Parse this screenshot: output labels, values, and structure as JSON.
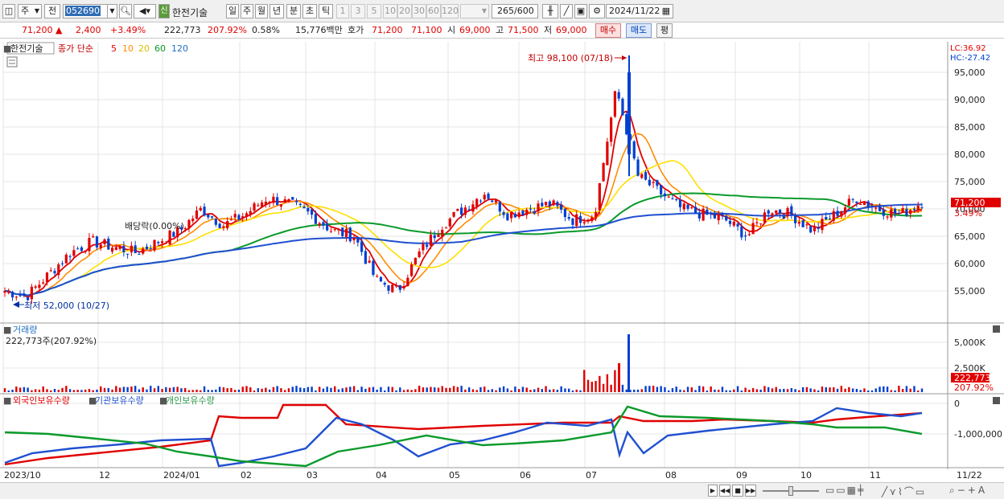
{
  "toolbar": {
    "mode_btn": "주",
    "prev_btn": "전",
    "code": "052690",
    "sin_badge": "신",
    "stock_name": "한전기술",
    "periods": [
      "일",
      "주",
      "월",
      "년",
      "분",
      "초",
      "틱"
    ],
    "selected_period": "일",
    "intervals": [
      "1",
      "3",
      "5",
      "10",
      "20",
      "30",
      "60",
      "120"
    ],
    "count": "265",
    "count_max": "/600",
    "date": "2024/11/22"
  },
  "quote": {
    "price": "71,200",
    "change": "2,400",
    "change_pct": "+3.49%",
    "volume": "222,773",
    "vol_ratio": "207.92%",
    "turnover": "0.58%",
    "amount": "15,776백만",
    "ask_label": "호가",
    "ask1": "71,200",
    "ask2": "71,100",
    "open_label": "시",
    "open": "69,000",
    "high_label": "고",
    "high": "71,500",
    "low_label": "저",
    "low": "69,000",
    "buy_btn": "매수",
    "sell_btn": "매도",
    "avg_btn": "평"
  },
  "price_panel": {
    "title_tag": "한전기술",
    "ma_label": "종가 단순",
    "ma_periods": [
      {
        "label": "5",
        "color": "#e00000"
      },
      {
        "label": "10",
        "color": "#ff8c00"
      },
      {
        "label": "20",
        "color": "#e8d000"
      },
      {
        "label": "60",
        "color": "#0a9a2a"
      },
      {
        "label": "120",
        "color": "#2040d0"
      }
    ],
    "lc_label": "LC:36.92",
    "hc_label": "HC:-27.42",
    "high_note": "최고 98,100 (07/18)",
    "low_note": "최저 52,000 (10/27)",
    "dividend_note": "배당락(0.00%)",
    "last_price_tag": "71,200",
    "last_pct_tag": "3.49%",
    "y_ticks": [
      "95,000",
      "90,000",
      "85,000",
      "80,000",
      "75,000",
      "70,000",
      "65,000",
      "60,000",
      "55,000"
    ]
  },
  "volume_panel": {
    "title": "거래량",
    "sub": "222,773주(207.92%)",
    "y_ticks": [
      "5,000K",
      "2,500K"
    ],
    "last_tag": "222,773",
    "last_pct": "207.92%"
  },
  "holding_panel": {
    "legend": [
      {
        "label": "외국인보유수량",
        "color": "#e00000"
      },
      {
        "label": "기관보유수량",
        "color": "#2050d0"
      },
      {
        "label": "개인보유수량",
        "color": "#2a9a4a"
      }
    ],
    "y_ticks": [
      "0",
      "-1,000,000"
    ]
  },
  "x_axis": {
    "labels": [
      "2023/10",
      "12",
      "2024/01",
      "02",
      "03",
      "04",
      "05",
      "06",
      "07",
      "08",
      "09",
      "10",
      "11",
      "11/22"
    ]
  },
  "colors": {
    "up": "#e00000",
    "down": "#0040d0",
    "ma5": "#e00000",
    "ma10": "#ff8c00",
    "ma20": "#ffe000",
    "ma60": "#0a9a2a",
    "ma120": "#2050d0"
  },
  "chart_data": {
    "type": "line",
    "title": "한전기술",
    "series": [
      {
        "name": "종가",
        "values": [
          55000,
          54000,
          58000,
          62000,
          64000,
          63000,
          62000,
          64000,
          66000,
          70000,
          67000,
          69000,
          72000,
          71000,
          69000,
          66000,
          65000,
          57000,
          55000,
          62000,
          67000,
          70000,
          73000,
          69000,
          70000,
          71000,
          68000,
          69000,
          92000,
          76000,
          73000,
          70000,
          69000,
          68000,
          65000,
          70000,
          69000,
          66000,
          69000,
          72000,
          70000,
          69000,
          71200
        ]
      }
    ],
    "high": {
      "value": 98100,
      "date": "07/18"
    },
    "low": {
      "value": 52000,
      "date": "10/27"
    },
    "ylim": [
      50000,
      99000
    ]
  }
}
